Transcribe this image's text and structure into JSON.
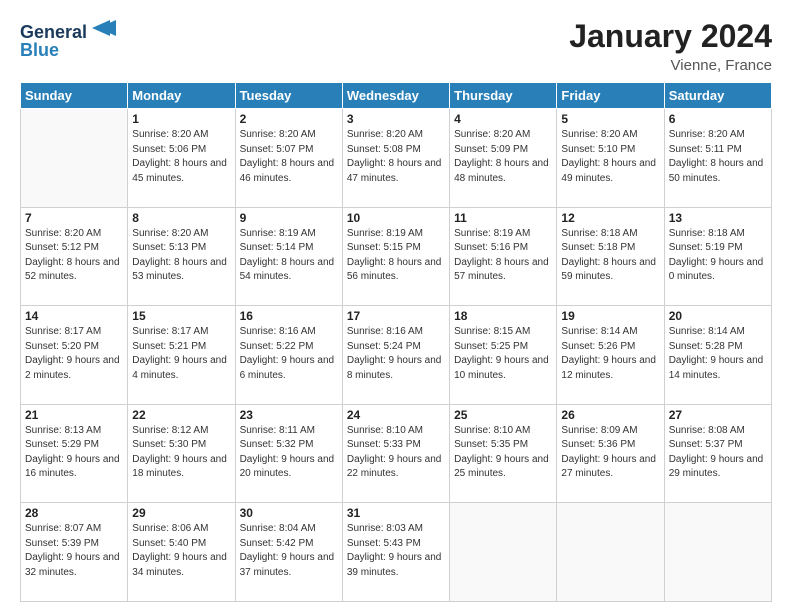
{
  "header": {
    "logo_line1": "General",
    "logo_line2": "Blue",
    "month": "January 2024",
    "location": "Vienne, France"
  },
  "weekdays": [
    "Sunday",
    "Monday",
    "Tuesday",
    "Wednesday",
    "Thursday",
    "Friday",
    "Saturday"
  ],
  "weeks": [
    [
      {
        "day": "",
        "sunrise": "",
        "sunset": "",
        "daylight": ""
      },
      {
        "day": "1",
        "sunrise": "Sunrise: 8:20 AM",
        "sunset": "Sunset: 5:06 PM",
        "daylight": "Daylight: 8 hours and 45 minutes."
      },
      {
        "day": "2",
        "sunrise": "Sunrise: 8:20 AM",
        "sunset": "Sunset: 5:07 PM",
        "daylight": "Daylight: 8 hours and 46 minutes."
      },
      {
        "day": "3",
        "sunrise": "Sunrise: 8:20 AM",
        "sunset": "Sunset: 5:08 PM",
        "daylight": "Daylight: 8 hours and 47 minutes."
      },
      {
        "day": "4",
        "sunrise": "Sunrise: 8:20 AM",
        "sunset": "Sunset: 5:09 PM",
        "daylight": "Daylight: 8 hours and 48 minutes."
      },
      {
        "day": "5",
        "sunrise": "Sunrise: 8:20 AM",
        "sunset": "Sunset: 5:10 PM",
        "daylight": "Daylight: 8 hours and 49 minutes."
      },
      {
        "day": "6",
        "sunrise": "Sunrise: 8:20 AM",
        "sunset": "Sunset: 5:11 PM",
        "daylight": "Daylight: 8 hours and 50 minutes."
      }
    ],
    [
      {
        "day": "7",
        "sunrise": "Sunrise: 8:20 AM",
        "sunset": "Sunset: 5:12 PM",
        "daylight": "Daylight: 8 hours and 52 minutes."
      },
      {
        "day": "8",
        "sunrise": "Sunrise: 8:20 AM",
        "sunset": "Sunset: 5:13 PM",
        "daylight": "Daylight: 8 hours and 53 minutes."
      },
      {
        "day": "9",
        "sunrise": "Sunrise: 8:19 AM",
        "sunset": "Sunset: 5:14 PM",
        "daylight": "Daylight: 8 hours and 54 minutes."
      },
      {
        "day": "10",
        "sunrise": "Sunrise: 8:19 AM",
        "sunset": "Sunset: 5:15 PM",
        "daylight": "Daylight: 8 hours and 56 minutes."
      },
      {
        "day": "11",
        "sunrise": "Sunrise: 8:19 AM",
        "sunset": "Sunset: 5:16 PM",
        "daylight": "Daylight: 8 hours and 57 minutes."
      },
      {
        "day": "12",
        "sunrise": "Sunrise: 8:18 AM",
        "sunset": "Sunset: 5:18 PM",
        "daylight": "Daylight: 8 hours and 59 minutes."
      },
      {
        "day": "13",
        "sunrise": "Sunrise: 8:18 AM",
        "sunset": "Sunset: 5:19 PM",
        "daylight": "Daylight: 9 hours and 0 minutes."
      }
    ],
    [
      {
        "day": "14",
        "sunrise": "Sunrise: 8:17 AM",
        "sunset": "Sunset: 5:20 PM",
        "daylight": "Daylight: 9 hours and 2 minutes."
      },
      {
        "day": "15",
        "sunrise": "Sunrise: 8:17 AM",
        "sunset": "Sunset: 5:21 PM",
        "daylight": "Daylight: 9 hours and 4 minutes."
      },
      {
        "day": "16",
        "sunrise": "Sunrise: 8:16 AM",
        "sunset": "Sunset: 5:22 PM",
        "daylight": "Daylight: 9 hours and 6 minutes."
      },
      {
        "day": "17",
        "sunrise": "Sunrise: 8:16 AM",
        "sunset": "Sunset: 5:24 PM",
        "daylight": "Daylight: 9 hours and 8 minutes."
      },
      {
        "day": "18",
        "sunrise": "Sunrise: 8:15 AM",
        "sunset": "Sunset: 5:25 PM",
        "daylight": "Daylight: 9 hours and 10 minutes."
      },
      {
        "day": "19",
        "sunrise": "Sunrise: 8:14 AM",
        "sunset": "Sunset: 5:26 PM",
        "daylight": "Daylight: 9 hours and 12 minutes."
      },
      {
        "day": "20",
        "sunrise": "Sunrise: 8:14 AM",
        "sunset": "Sunset: 5:28 PM",
        "daylight": "Daylight: 9 hours and 14 minutes."
      }
    ],
    [
      {
        "day": "21",
        "sunrise": "Sunrise: 8:13 AM",
        "sunset": "Sunset: 5:29 PM",
        "daylight": "Daylight: 9 hours and 16 minutes."
      },
      {
        "day": "22",
        "sunrise": "Sunrise: 8:12 AM",
        "sunset": "Sunset: 5:30 PM",
        "daylight": "Daylight: 9 hours and 18 minutes."
      },
      {
        "day": "23",
        "sunrise": "Sunrise: 8:11 AM",
        "sunset": "Sunset: 5:32 PM",
        "daylight": "Daylight: 9 hours and 20 minutes."
      },
      {
        "day": "24",
        "sunrise": "Sunrise: 8:10 AM",
        "sunset": "Sunset: 5:33 PM",
        "daylight": "Daylight: 9 hours and 22 minutes."
      },
      {
        "day": "25",
        "sunrise": "Sunrise: 8:10 AM",
        "sunset": "Sunset: 5:35 PM",
        "daylight": "Daylight: 9 hours and 25 minutes."
      },
      {
        "day": "26",
        "sunrise": "Sunrise: 8:09 AM",
        "sunset": "Sunset: 5:36 PM",
        "daylight": "Daylight: 9 hours and 27 minutes."
      },
      {
        "day": "27",
        "sunrise": "Sunrise: 8:08 AM",
        "sunset": "Sunset: 5:37 PM",
        "daylight": "Daylight: 9 hours and 29 minutes."
      }
    ],
    [
      {
        "day": "28",
        "sunrise": "Sunrise: 8:07 AM",
        "sunset": "Sunset: 5:39 PM",
        "daylight": "Daylight: 9 hours and 32 minutes."
      },
      {
        "day": "29",
        "sunrise": "Sunrise: 8:06 AM",
        "sunset": "Sunset: 5:40 PM",
        "daylight": "Daylight: 9 hours and 34 minutes."
      },
      {
        "day": "30",
        "sunrise": "Sunrise: 8:04 AM",
        "sunset": "Sunset: 5:42 PM",
        "daylight": "Daylight: 9 hours and 37 minutes."
      },
      {
        "day": "31",
        "sunrise": "Sunrise: 8:03 AM",
        "sunset": "Sunset: 5:43 PM",
        "daylight": "Daylight: 9 hours and 39 minutes."
      },
      {
        "day": "",
        "sunrise": "",
        "sunset": "",
        "daylight": ""
      },
      {
        "day": "",
        "sunrise": "",
        "sunset": "",
        "daylight": ""
      },
      {
        "day": "",
        "sunrise": "",
        "sunset": "",
        "daylight": ""
      }
    ]
  ]
}
